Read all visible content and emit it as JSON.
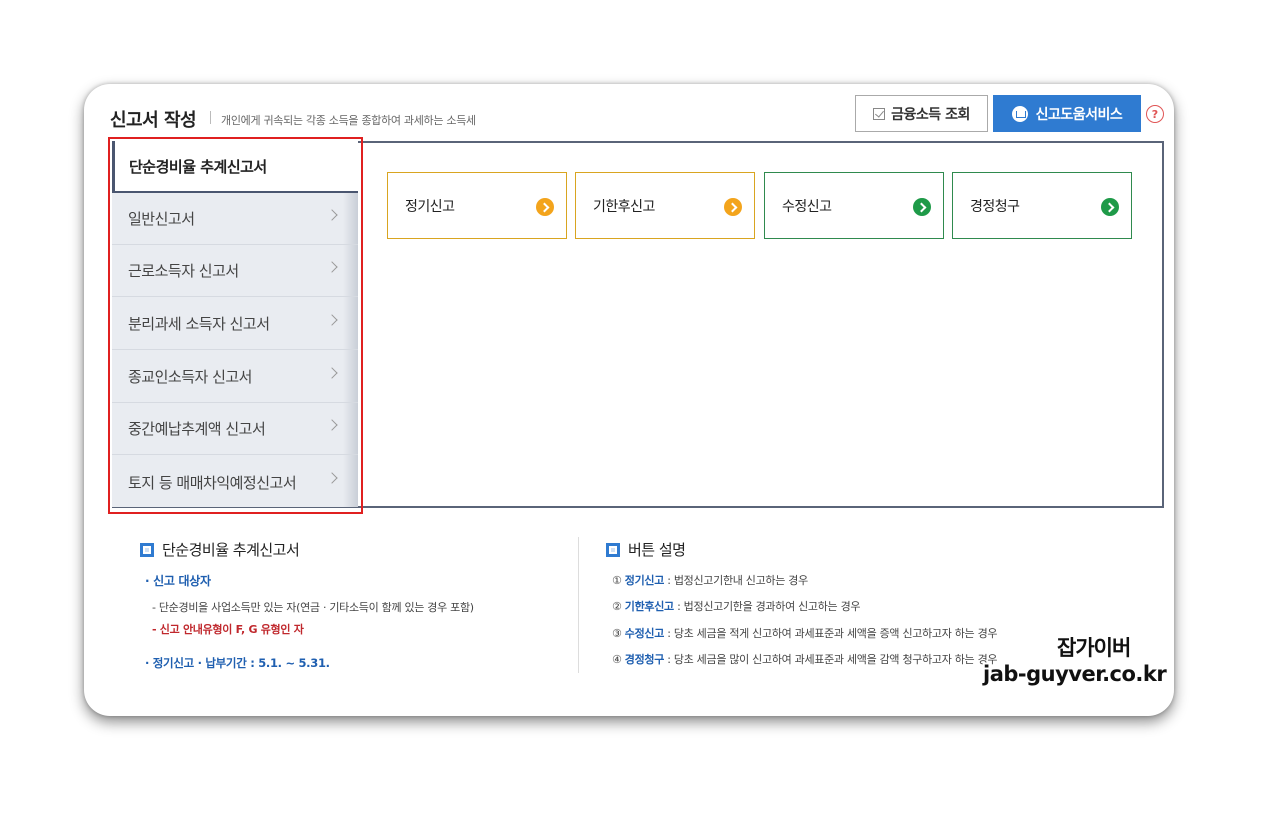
{
  "header": {
    "title": "신고서 작성",
    "description": "개인에게 귀속되는 각종 소득을 종합하여 과세하는 소득세",
    "btn_financial": "금융소득 조회",
    "btn_help_service": "신고도움서비스",
    "help_icon": "?"
  },
  "sidebar": {
    "active": "단순경비율 추계신고서",
    "items": [
      "일반신고서",
      "근로소득자 신고서",
      "분리과세 소득자 신고서",
      "종교인소득자 신고서",
      "중간예납추계액 신고서",
      "토지 등 매매차익예정신고서"
    ]
  },
  "actions": [
    {
      "label": "정기신고",
      "color": "#f3a41c"
    },
    {
      "label": "기한후신고",
      "color": "#f3a41c"
    },
    {
      "label": "수정신고",
      "color": "#1e9a48"
    },
    {
      "label": "경정청구",
      "color": "#1e9a48"
    }
  ],
  "info_left": {
    "heading": "단순경비율 추계신고서",
    "target_label": "· 신고 대상자",
    "target_detail": "- 단순경비을 사업소득만 있는 자(연금 · 기타소득이 함께 있는 경우 포함)",
    "target_red": "- 신고 안내유형이 F, G 유형인 자",
    "period": "· 정기신고 · 납부기간 : 5.1. ~ 5.31."
  },
  "info_right": {
    "heading": "버튼 설명",
    "lines": [
      {
        "num": "①",
        "name": "정기신고",
        "desc": " : 법정신고기한내 신고하는 경우"
      },
      {
        "num": "②",
        "name": "기한후신고",
        "desc": " : 법정신고기한을 경과하여 신고하는 경우"
      },
      {
        "num": "③",
        "name": "수정신고",
        "desc": " : 당초 세금을 적게 신고하여 과세표준과 세액을 증액 신고하고자 하는 경우"
      },
      {
        "num": "④",
        "name": "경정청구",
        "desc": " : 당초 세금을 많이 신고하여 과세표준과 세액을 감액 청구하고자 하는 경우"
      }
    ]
  },
  "watermark": {
    "name": "잡가이버",
    "url": "jab-guyver.co.kr"
  },
  "colors": {
    "accent_blue": "#2f7bd1",
    "highlight_red": "#e02020",
    "orange": "#f3a41c",
    "green": "#1e9a48"
  }
}
